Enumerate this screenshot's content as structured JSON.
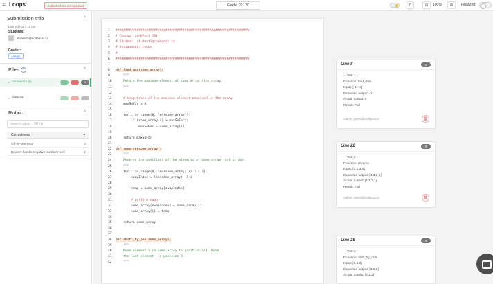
{
  "topbar": {
    "menu_icon": "≡",
    "title": "Loops",
    "badge": "published but not finalized",
    "grade": "Grade: 20 / 20",
    "undo_icon": "↶",
    "zoom_out_icon": "⊖",
    "zoom": "100%",
    "zoom_in_icon": "⊕",
    "finalized_label": "Finalized:"
  },
  "sidebar": {
    "submission_title": "Submission Info",
    "last_edit": "Last edit at 7:18 pm",
    "students_label": "Students:",
    "student": "student1@codepost.io",
    "grader_label": "Grader:",
    "assign_label": "Assign",
    "files_title": "Files",
    "files_help": "?",
    "files": [
      {
        "name": "homework.py",
        "active": true,
        "count": "0"
      },
      {
        "name": "tests.txt",
        "active": false,
        "count": ""
      }
    ],
    "rubric_title": "Rubric",
    "rubric_search_placeholder": "Search rubric... (⌘ O)",
    "rubric_category": "Correctness",
    "rubric_items": [
      {
        "label": "Off-by-one error",
        "value": "2"
      },
      {
        "label": "Doesn't handle negative numbers well",
        "value": "1"
      }
    ]
  },
  "code": {
    "lines": [
      {
        "n": "1",
        "text": "######################################################################",
        "kind": "comment",
        "hl": false
      },
      {
        "n": "2",
        "text": "# Course: codePost 101",
        "kind": "comment",
        "hl": false
      },
      {
        "n": "3",
        "text": "# Student: student1@codepost.io",
        "kind": "comment",
        "hl": false
      },
      {
        "n": "4",
        "text": "# Assignment: Loops",
        "kind": "comment",
        "hl": false
      },
      {
        "n": "5",
        "text": "#",
        "kind": "comment",
        "hl": false
      },
      {
        "n": "6",
        "text": "######################################################################",
        "kind": "comment",
        "hl": false
      },
      {
        "n": "7",
        "text": "",
        "kind": "code",
        "hl": false
      },
      {
        "n": "8",
        "text": "def find_max(some_array):",
        "kind": "code",
        "hl": true
      },
      {
        "n": "9",
        "text": "    \"\"\"",
        "kind": "doc",
        "hl": false
      },
      {
        "n": "10",
        "text": "    Return the maximum element of some_array (int array).",
        "kind": "doc",
        "hl": false
      },
      {
        "n": "11",
        "text": "    \"\"\"",
        "kind": "doc",
        "hl": false
      },
      {
        "n": "12",
        "text": "",
        "kind": "code",
        "hl": false
      },
      {
        "n": "13",
        "text": "    # keep track of the maximum element observed in the array",
        "kind": "comment",
        "hl": false
      },
      {
        "n": "14",
        "text": "    maxSoFar = 0",
        "kind": "code",
        "hl": false
      },
      {
        "n": "15",
        "text": "",
        "kind": "code",
        "hl": false
      },
      {
        "n": "16",
        "text": "    for i in range(0, len(some_array)):",
        "kind": "code",
        "hl": false
      },
      {
        "n": "17",
        "text": "        if (some_array[i] > maxSoFar):",
        "kind": "code",
        "hl": false
      },
      {
        "n": "18",
        "text": "            maxSoFar = some_array[i]",
        "kind": "code",
        "hl": false
      },
      {
        "n": "19",
        "text": "",
        "kind": "code",
        "hl": false
      },
      {
        "n": "20",
        "text": "    return maxSoFar",
        "kind": "code",
        "hl": false
      },
      {
        "n": "21",
        "text": "",
        "kind": "code",
        "hl": false
      },
      {
        "n": "22",
        "text": "def reverse(some_array):",
        "kind": "code",
        "hl": true
      },
      {
        "n": "23",
        "text": "    \"\"\"",
        "kind": "doc",
        "hl": false
      },
      {
        "n": "24",
        "text": "    Reverse the positions of the elements of some_array (int array).",
        "kind": "doc",
        "hl": false
      },
      {
        "n": "25",
        "text": "    \"\"\"",
        "kind": "doc",
        "hl": false
      },
      {
        "n": "26",
        "text": "    for i in range(0, len(some_array) // 2 + 1):",
        "kind": "code",
        "hl": false
      },
      {
        "n": "27",
        "text": "        swapIndex = len(some_array) -1-i",
        "kind": "code",
        "hl": false
      },
      {
        "n": "28",
        "text": "",
        "kind": "code",
        "hl": false
      },
      {
        "n": "29",
        "text": "        temp = some_array[swapIndex]",
        "kind": "code",
        "hl": false
      },
      {
        "n": "30",
        "text": "",
        "kind": "code",
        "hl": false
      },
      {
        "n": "31",
        "text": "        # perform swap",
        "kind": "comment",
        "hl": false
      },
      {
        "n": "32",
        "text": "        some_array[swapIndex] = some_array[i]",
        "kind": "code",
        "hl": false
      },
      {
        "n": "33",
        "text": "        some_array[i] = temp",
        "kind": "code",
        "hl": false
      },
      {
        "n": "34",
        "text": "",
        "kind": "code",
        "hl": false
      },
      {
        "n": "35",
        "text": "    return some_array",
        "kind": "code",
        "hl": false
      },
      {
        "n": "36",
        "text": "",
        "kind": "code",
        "hl": false
      },
      {
        "n": "37",
        "text": "",
        "kind": "code",
        "hl": false
      },
      {
        "n": "38",
        "text": "def shift_by_one(some_array):",
        "kind": "code",
        "hl": true
      },
      {
        "n": "39",
        "text": "    \"\"\"",
        "kind": "doc",
        "hl": false
      },
      {
        "n": "40",
        "text": "    Move element i in some_array to position i+1. Move",
        "kind": "doc",
        "hl": false
      },
      {
        "n": "41",
        "text": "    the last element  in position 0.",
        "kind": "doc",
        "hl": false
      },
      {
        "n": "42",
        "text": "    \"\"\"",
        "kind": "doc",
        "hl": false
      }
    ]
  },
  "comments": [
    {
      "title": "Line 8",
      "points": "0",
      "body": [
        "- Test 1 -",
        "Function: find_max",
        "Input: [-1, -2]",
        "Expected output: -1",
        "Actual output: 0",
        "Result: Fail"
      ],
      "author": "Author: james@codepost.io"
    },
    {
      "title": "Line 22",
      "points": "0",
      "body": [
        "- Test 2 -",
        "Function: reverse",
        "Input: [1,2,3,4]",
        "Expected output: [4,3,2,1]",
        "Actual output: [4,2,3,1]",
        "Result: Fail"
      ],
      "author": "Author: james@codepost.io"
    },
    {
      "title": "Line 38",
      "points": "0",
      "body": [
        "- Test 3 -",
        "Function: shift_by_one",
        "Input: [1,2,3]",
        "Expected output: [3,1,2]",
        "Actual output: [3,1,2]"
      ],
      "author": ""
    }
  ],
  "colors": {
    "accent_green": "#4caf73",
    "pill_green": "#7fc598",
    "pill_red": "#e07070",
    "comment_red": "#b75a5a",
    "docstring_green": "#4a8a4a"
  }
}
